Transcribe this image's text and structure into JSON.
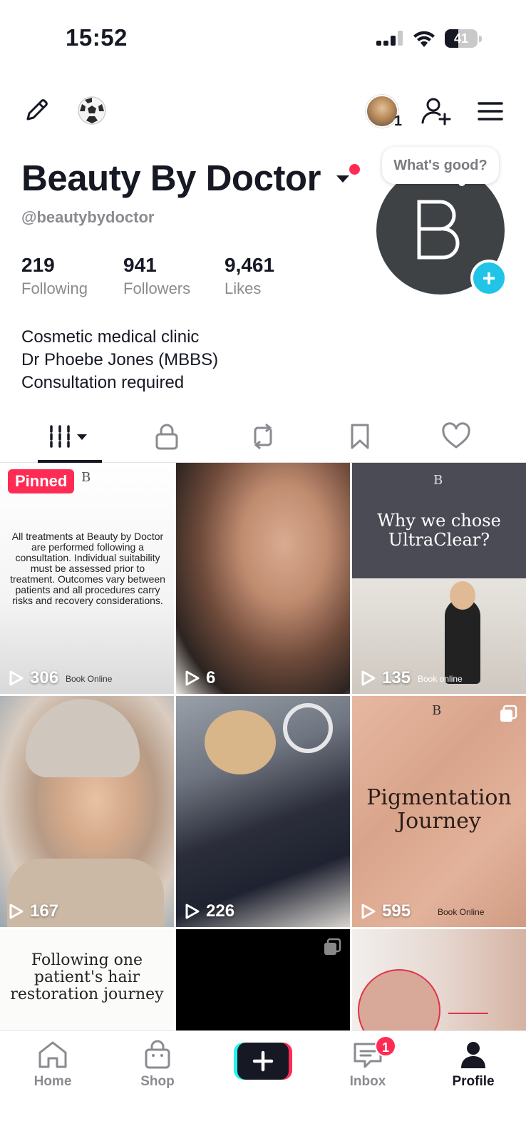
{
  "status_bar": {
    "time": "15:52",
    "battery_level": "41",
    "battery_fraction": 0.41,
    "icons": [
      "signal-icon",
      "wifi-icon",
      "battery-icon"
    ]
  },
  "top_bar": {
    "avatar_count": "1",
    "icons": [
      "pencil-icon",
      "soccer-ball-icon",
      "add-user-icon",
      "menu-icon"
    ]
  },
  "profile": {
    "name": "Beauty By Doctor",
    "handle": "@beautybydoctor",
    "avatar_logo": "B",
    "bubble_text": "What's good?",
    "add_button": "+",
    "stats": [
      {
        "value": "219",
        "label": "Following"
      },
      {
        "value": "941",
        "label": "Followers"
      },
      {
        "value": "9,461",
        "label": "Likes"
      }
    ],
    "bio": [
      "Cosmetic medical clinic",
      "Dr Phoebe Jones (MBBS)",
      "Consultation required"
    ]
  },
  "tabs": [
    {
      "icon": "grid-icon",
      "active": true
    },
    {
      "icon": "lock-icon",
      "active": false
    },
    {
      "icon": "repost-icon",
      "active": false
    },
    {
      "icon": "bookmark-icon",
      "active": false
    },
    {
      "icon": "heart-icon",
      "active": false
    }
  ],
  "videos": [
    {
      "pinned_label": "Pinned",
      "logo": "B",
      "text": "All treatments at Beauty by Doctor are performed following a consultation. Individual suitability must be assessed prior to treatment. Outcomes vary between patients and all procedures carry risks and recovery considerations.",
      "views": "306",
      "overlay": "Book Online"
    },
    {
      "views": "6"
    },
    {
      "logo": "B",
      "title": "Why we chose UltraClear?",
      "views": "135",
      "overlay": "Book online"
    },
    {
      "views": "167"
    },
    {
      "views": "226"
    },
    {
      "logo": "B",
      "title": "Pigmentation Journey",
      "views": "595",
      "overlay": "Book Online"
    },
    {
      "title": "Following one patient's hair restoration journey"
    },
    {},
    {}
  ],
  "bottom_nav": {
    "items": [
      {
        "label": "Home",
        "icon": "home-icon"
      },
      {
        "label": "Shop",
        "icon": "shop-icon"
      },
      {
        "label": "",
        "icon": "create-plus-icon"
      },
      {
        "label": "Inbox",
        "icon": "inbox-icon",
        "badge": "1"
      },
      {
        "label": "Profile",
        "icon": "profile-icon"
      }
    ]
  },
  "colors": {
    "accent": "#fe2c55",
    "cyan": "#20c4e6",
    "text": "#161823",
    "muted": "#8a8b91"
  }
}
